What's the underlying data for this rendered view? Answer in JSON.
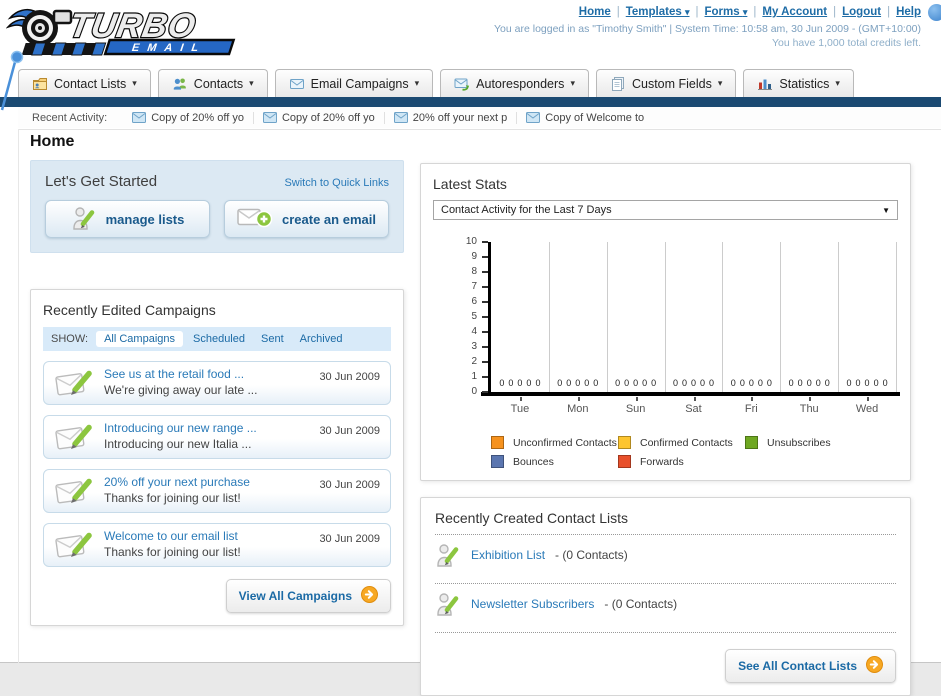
{
  "page_title": "Home",
  "colors": {
    "navy_bar": "#1b4a72",
    "link_blue": "#1e6ca6",
    "accent_orange": "#f7a823",
    "accent_green": "#8cc63f",
    "panel_blue_bg": "#dce9f3"
  },
  "header": {
    "logo_line1": "TURBO",
    "logo_line2": "EMAIL",
    "nav": [
      {
        "label": "Home",
        "dropdown": false
      },
      {
        "label": "Templates",
        "dropdown": true
      },
      {
        "label": "Forms",
        "dropdown": true
      },
      {
        "label": "My Account",
        "dropdown": false
      },
      {
        "label": "Logout",
        "dropdown": false
      },
      {
        "label": "Help",
        "dropdown": false
      }
    ],
    "login_line": "You are logged in as \"Timothy Smith\" | System Time: 10:58 am, 30 Jun 2009 - (GMT+10:00)",
    "credits_line": "You have 1,000 total credits left."
  },
  "tabs": [
    {
      "label": "Contact Lists",
      "icon": "contact-lists-icon"
    },
    {
      "label": "Contacts",
      "icon": "contacts-icon"
    },
    {
      "label": "Email Campaigns",
      "icon": "email-campaigns-icon"
    },
    {
      "label": "Autoresponders",
      "icon": "autoresponders-icon"
    },
    {
      "label": "Custom Fields",
      "icon": "custom-fields-icon"
    },
    {
      "label": "Statistics",
      "icon": "statistics-icon"
    }
  ],
  "recent_activity": {
    "label": "Recent Activity:",
    "items": [
      "Copy of 20% off yo",
      "Copy of 20% off yo",
      "20% off your next p",
      "Copy of Welcome to"
    ]
  },
  "get_started": {
    "title": "Let's Get Started",
    "switch_link": "Switch to Quick Links",
    "manage_lists_label": "manage lists",
    "create_email_label": "create an email"
  },
  "campaigns": {
    "title": "Recently Edited Campaigns",
    "show_label": "SHOW:",
    "filters": [
      "All Campaigns",
      "Scheduled",
      "Sent",
      "Archived"
    ],
    "active_filter": "All Campaigns",
    "items": [
      {
        "title": "See us at the retail food ...",
        "subtitle": "We're giving away our late ...",
        "date": "30 Jun 2009"
      },
      {
        "title": "Introducing our new range ...",
        "subtitle": "Introducing our new Italia ...",
        "date": "30 Jun 2009"
      },
      {
        "title": "20% off your next purchase",
        "subtitle": "Thanks for joining our list!",
        "date": "30 Jun 2009"
      },
      {
        "title": "Welcome to our email list",
        "subtitle": "Thanks for joining our list!",
        "date": "30 Jun 2009"
      }
    ],
    "view_all_label": "View All Campaigns"
  },
  "latest_stats": {
    "title": "Latest Stats",
    "dropdown_value": "Contact Activity for the Last 7 Days"
  },
  "chart_data": {
    "type": "bar",
    "title": "Contact Activity for the Last 7 Days",
    "categories": [
      "Tue",
      "Mon",
      "Sun",
      "Sat",
      "Fri",
      "Thu",
      "Wed"
    ],
    "series": [
      {
        "name": "Unconfirmed Contacts",
        "color": "#f6921e",
        "values": [
          0,
          0,
          0,
          0,
          0,
          0,
          0
        ]
      },
      {
        "name": "Confirmed Contacts",
        "color": "#fdc52f",
        "values": [
          0,
          0,
          0,
          0,
          0,
          0,
          0
        ]
      },
      {
        "name": "Unsubscribes",
        "color": "#6fa822",
        "values": [
          0,
          0,
          0,
          0,
          0,
          0,
          0
        ]
      },
      {
        "name": "Bounces",
        "color": "#5b76b0",
        "values": [
          0,
          0,
          0,
          0,
          0,
          0,
          0
        ]
      },
      {
        "name": "Forwards",
        "color": "#e8502b",
        "values": [
          0,
          0,
          0,
          0,
          0,
          0,
          0
        ]
      }
    ],
    "ylim": [
      0,
      10
    ],
    "yticks": [
      0,
      1,
      2,
      3,
      4,
      5,
      6,
      7,
      8,
      9,
      10
    ],
    "grid": "vertical",
    "legend_position": "bottom"
  },
  "contact_lists": {
    "title": "Recently Created Contact Lists",
    "items": [
      {
        "name": "Exhibition List",
        "detail": "- (0 Contacts)"
      },
      {
        "name": "Newsletter Subscribers",
        "detail": "- (0 Contacts)"
      }
    ],
    "see_all_label": "See All Contact Lists"
  }
}
